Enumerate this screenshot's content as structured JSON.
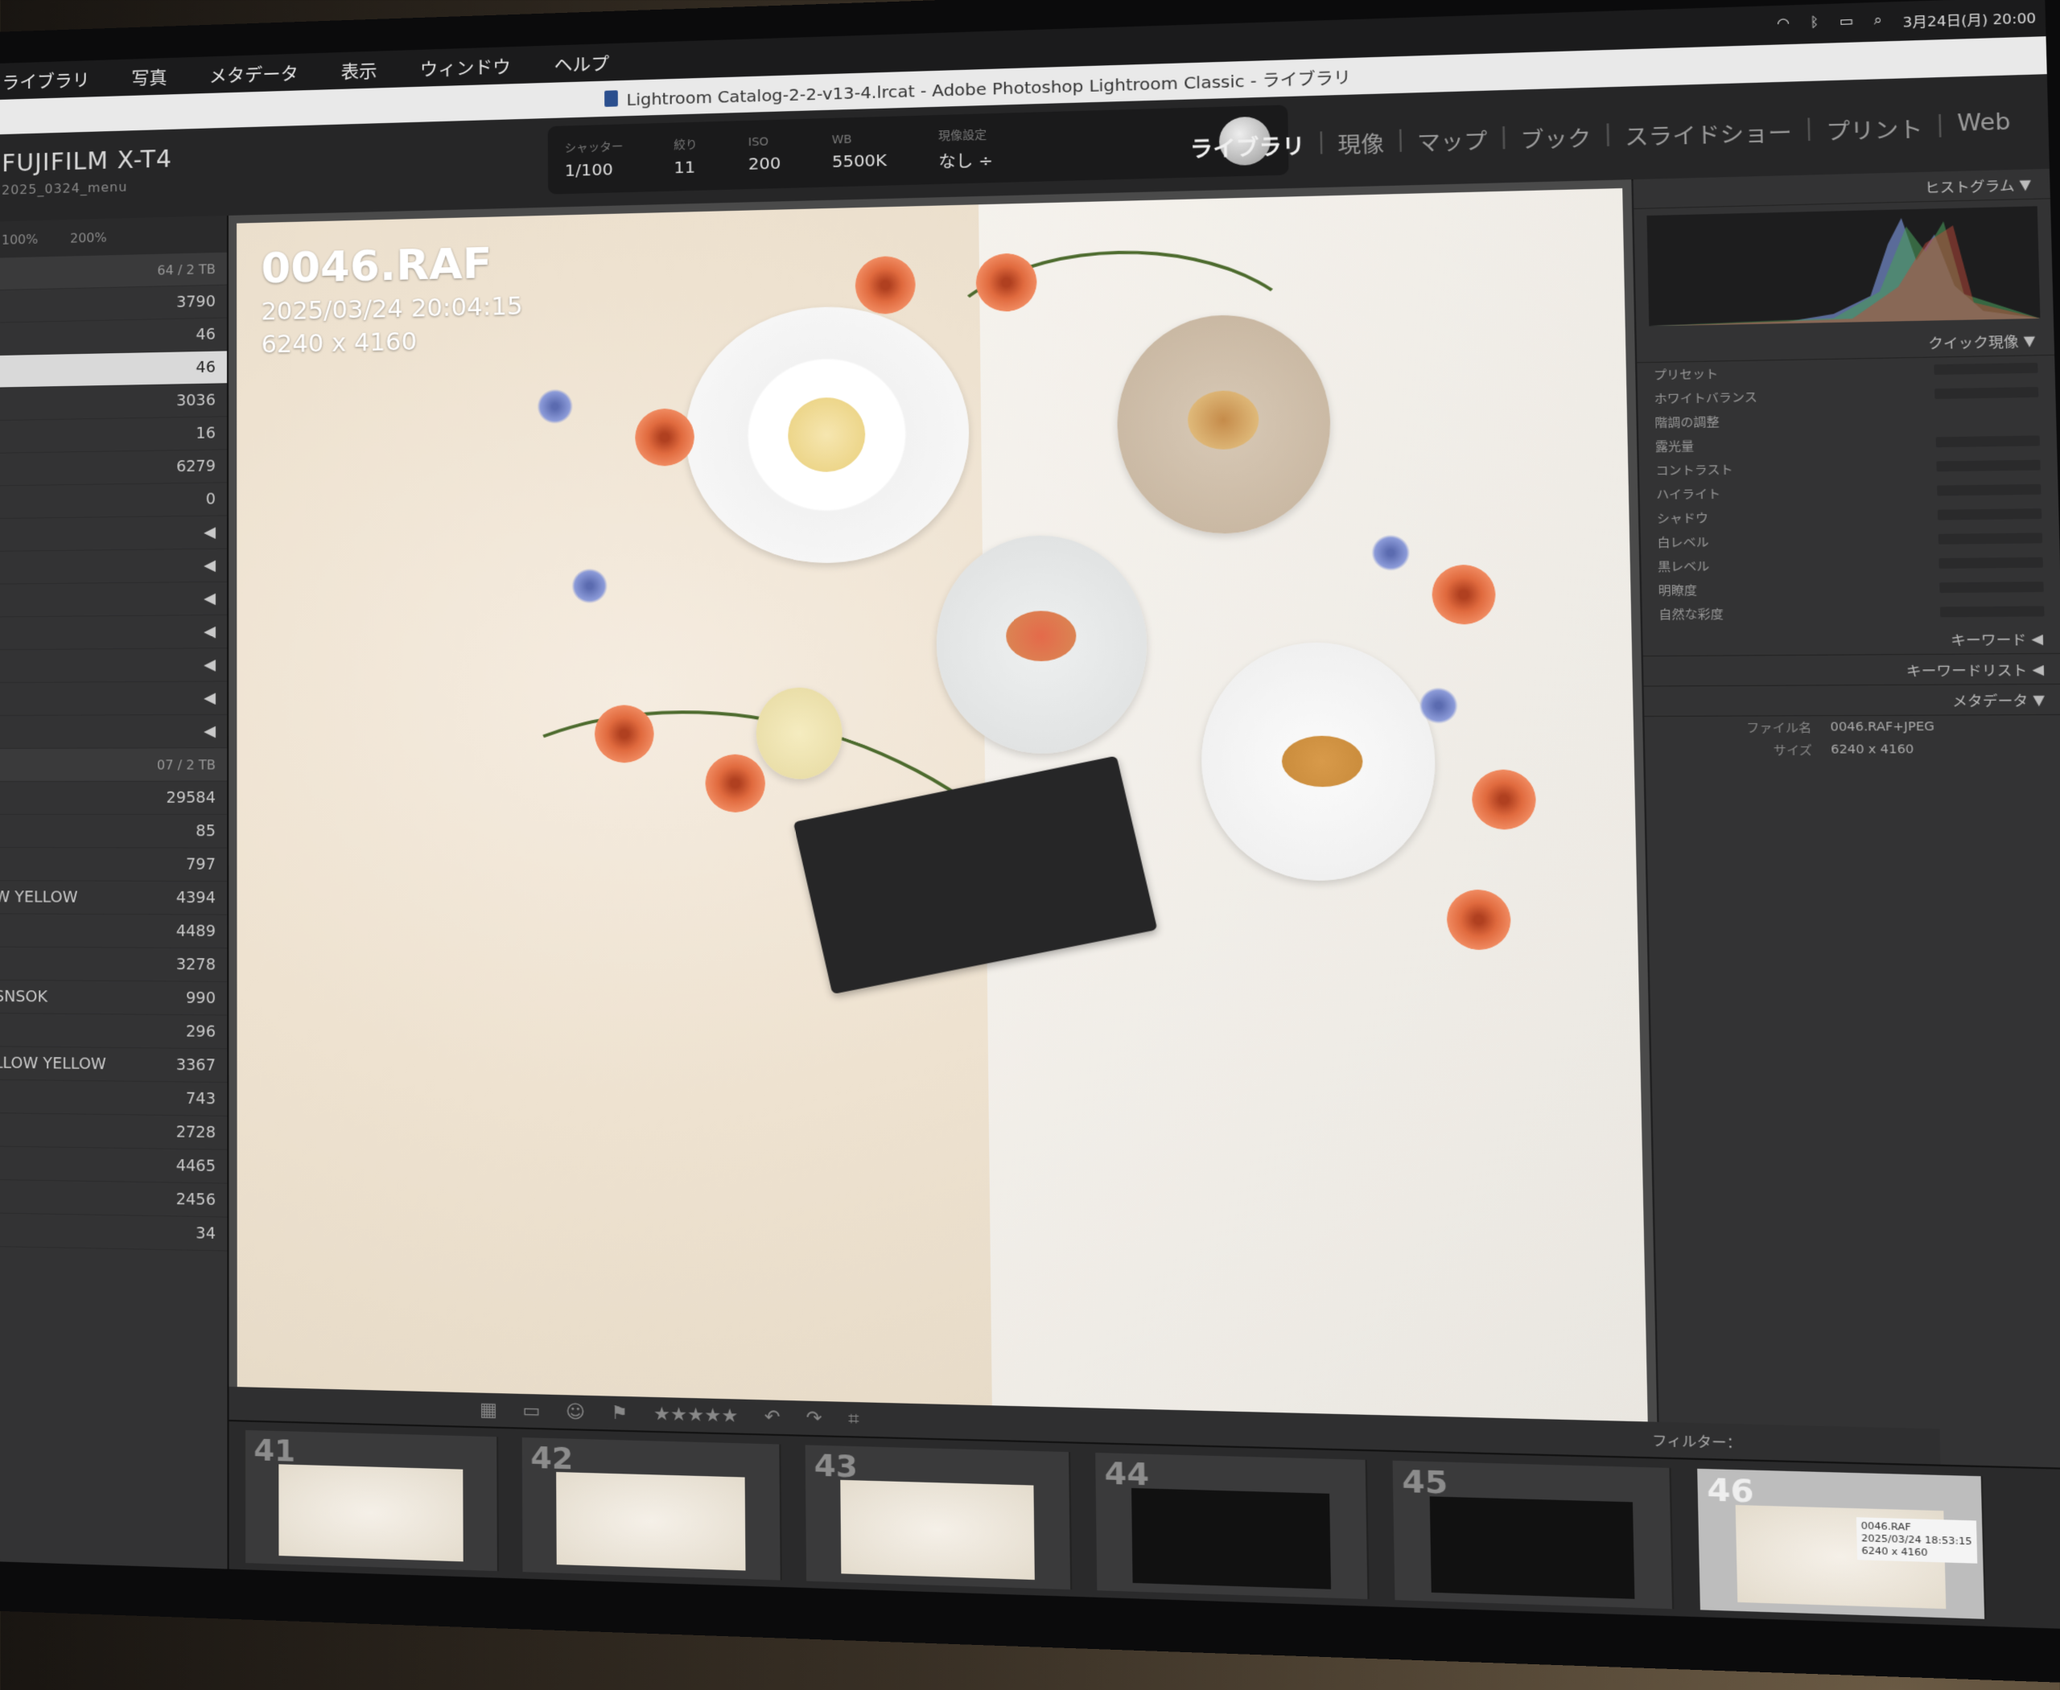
{
  "menubar": {
    "items": [
      "ライブラリ",
      "写真",
      "メタデータ",
      "表示",
      "ウィンドウ",
      "ヘルプ"
    ],
    "clock": "3月24日(月) 20:00"
  },
  "window": {
    "title": "Lightroom Catalog-2-2-v13-4.lrcat - Adobe Photoshop Lightroom Classic - ライブラリ"
  },
  "identity": {
    "name": "FUJIFILM X-T4",
    "sub": "2025_0324_menu"
  },
  "exif": [
    {
      "key": "シャッター",
      "value": "1/100"
    },
    {
      "key": "絞り",
      "value": "11"
    },
    {
      "key": "ISO",
      "value": "200"
    },
    {
      "key": "WB",
      "value": "5500K"
    },
    {
      "key": "現像設定",
      "value": "なし ÷"
    }
  ],
  "modules": [
    "ライブラリ",
    "現像",
    "マップ",
    "ブック",
    "スライドショー",
    "プリント",
    "Web"
  ],
  "left_panel": {
    "zoom": [
      "100%",
      "200%"
    ],
    "rows": [
      {
        "label": "",
        "count": "64 / 2 TB",
        "type": "head"
      },
      {
        "label": "",
        "count": "3790"
      },
      {
        "label": "",
        "count": "46"
      },
      {
        "label": "",
        "count": "46",
        "type": "sel"
      },
      {
        "label": "",
        "count": "3036"
      },
      {
        "label": "",
        "count": "16"
      },
      {
        "label": "",
        "count": "6279"
      },
      {
        "label": "",
        "count": "0"
      },
      {
        "label": "",
        "count": "◀"
      },
      {
        "label": "",
        "count": "◀"
      },
      {
        "label": "",
        "count": "◀"
      },
      {
        "label": "",
        "count": "◀"
      },
      {
        "label": "",
        "count": "◀"
      },
      {
        "label": "",
        "count": "◀"
      },
      {
        "label": "",
        "count": "◀"
      },
      {
        "label": "",
        "count": "07 / 2 TB",
        "type": "head"
      },
      {
        "label": "",
        "count": "29584"
      },
      {
        "label": "",
        "count": "85"
      },
      {
        "label": "",
        "count": "797"
      },
      {
        "label": "W YELLOW",
        "count": "4394"
      },
      {
        "label": "",
        "count": "4489"
      },
      {
        "label": "",
        "count": "3278"
      },
      {
        "label": "SNSOK",
        "count": "990"
      },
      {
        "label": "",
        "count": "296"
      },
      {
        "label": "LLOW YELLOW",
        "count": "3367"
      },
      {
        "label": "",
        "count": "743"
      },
      {
        "label": "",
        "count": "2728"
      },
      {
        "label": "",
        "count": "4465"
      },
      {
        "label": "",
        "count": "2456"
      },
      {
        "label": "",
        "count": "34"
      }
    ]
  },
  "photo": {
    "filename": "0046.RAF",
    "datetime": "2025/03/24 20:04:15",
    "dimensions": "6240 x 4160"
  },
  "right_panel": {
    "histogram_label": "ヒストグラム",
    "quick_develop": "クイック現像",
    "preset": "プリセット",
    "white_balance": "ホワイトバランス",
    "tone": "階調の調整",
    "sliders": [
      "露光量",
      "コントラスト",
      "ハイライト",
      "シャドウ",
      "白レベル",
      "黒レベル",
      "明瞭度",
      "自然な彩度"
    ],
    "keywords": "キーワード",
    "keyword_list": "キーワードリスト",
    "metadata": "メタデータ",
    "metadata_rows": [
      {
        "key": "ファイル名",
        "value": "0046.RAF+JPEG"
      },
      {
        "key": "サイズ",
        "value": "6240 x 4160"
      }
    ]
  },
  "filmstrip": {
    "filter_label": "フィルター：",
    "thumbs": [
      {
        "num": "41",
        "dark": false,
        "selected": false
      },
      {
        "num": "42",
        "dark": false,
        "selected": false
      },
      {
        "num": "43",
        "dark": false,
        "selected": false
      },
      {
        "num": "44",
        "dark": true,
        "selected": false
      },
      {
        "num": "45",
        "dark": true,
        "selected": false
      },
      {
        "num": "46",
        "dark": false,
        "selected": true
      }
    ],
    "tooltip": [
      "0046.RAF",
      "2025/03/24 18:53:15",
      "6240 x 4160"
    ]
  },
  "colors": {
    "accent": "#d9d9d9",
    "panel": "#333334",
    "background": "#1e1e1f"
  }
}
